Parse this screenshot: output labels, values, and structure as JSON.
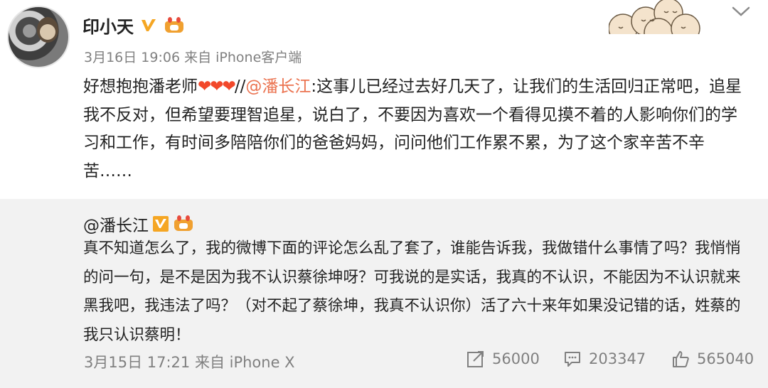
{
  "post": {
    "username": "印小天",
    "time": "3月16日 19:06 来自 iPhone客户端",
    "hearts": "❤❤❤",
    "text_prefix": "好想抱抱潘老师",
    "separator": "//",
    "mention": "@潘长江",
    "text_body": ":这事儿已经过去好几天了，让我们的生活回归正常吧，追星我不反对，但希望要理智追星，说白了，不要因为喜欢一个看得见摸不着的人影响你们的学习和工作，有时间多陪陪你们的爸爸妈妈，问问他们工作累不累，为了这个家辛苦不辛苦……"
  },
  "repost": {
    "username": "@潘长江",
    "text": "真不知道怎么了，我的微博下面的评论怎么乱了套了，谁能告诉我，我做错什么事情了吗？我悄悄的问一句，是不是因为我不认识蔡徐坤呀？可我说的是实话，我真的不认识，不能因为不认识就来黑我吧，我违法了吗？（对不起了蔡徐坤，我真不认识你）活了六十来年如果没记错的话，姓蔡的我只认识蔡明！",
    "time": "3月15日 17:21 来自 iPhone X",
    "shares": "56000",
    "comments": "203347",
    "likes": "565040"
  },
  "icons": {
    "verified": "verified-v-icon",
    "member": "crown-member-icon",
    "share": "share-icon",
    "comment": "comment-icon",
    "like": "thumbs-up-icon",
    "menu": "chevron-down-icon"
  },
  "colors": {
    "mention": "#eb7350",
    "verified": "#f5a623",
    "heart": "#f2482a",
    "muted": "#808080",
    "repost_bg": "#f2f2f2"
  }
}
